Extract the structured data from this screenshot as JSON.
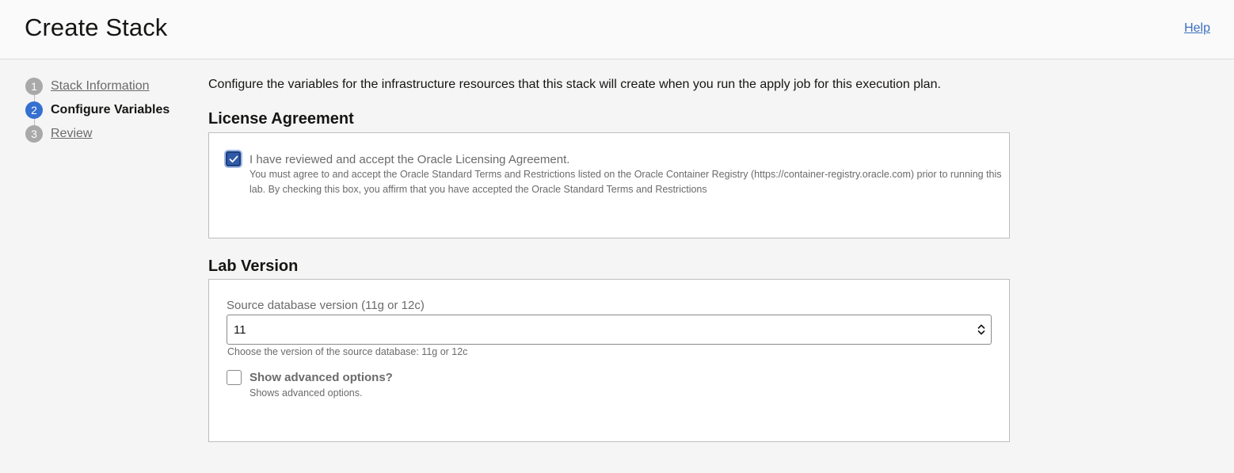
{
  "header": {
    "title": "Create Stack",
    "help_label": "Help"
  },
  "wizard": {
    "steps": [
      {
        "number": "1",
        "label": "Stack Information",
        "state": "completed"
      },
      {
        "number": "2",
        "label": "Configure Variables",
        "state": "active"
      },
      {
        "number": "3",
        "label": "Review",
        "state": "pending"
      }
    ]
  },
  "main": {
    "intro": "Configure the variables for the infrastructure resources that this stack will create when you run the apply job for this execution plan.",
    "license": {
      "title": "License Agreement",
      "checkbox_label": "I have reviewed and accept the Oracle Licensing Agreement.",
      "checked": true,
      "help_line1": "You must agree to and accept the Oracle Standard Terms and Restrictions listed on the Oracle Container Registry (https://container-registry.oracle.com) prior to running this",
      "help_line2": "lab. By checking this box, you affirm that you have accepted the Oracle Standard Terms and Restrictions"
    },
    "lab_version": {
      "title": "Lab Version",
      "field_label": "Source database version (11g or 12c)",
      "selected_value": "11",
      "field_help": "Choose the version of the source database: 11g or 12c",
      "advanced_label": "Show advanced options?",
      "advanced_checked": false,
      "advanced_help": "Shows advanced options."
    }
  },
  "colors": {
    "accent": "#3570d0",
    "link": "#3a6fbf",
    "checkbox_checked": "#2f5aa8"
  }
}
